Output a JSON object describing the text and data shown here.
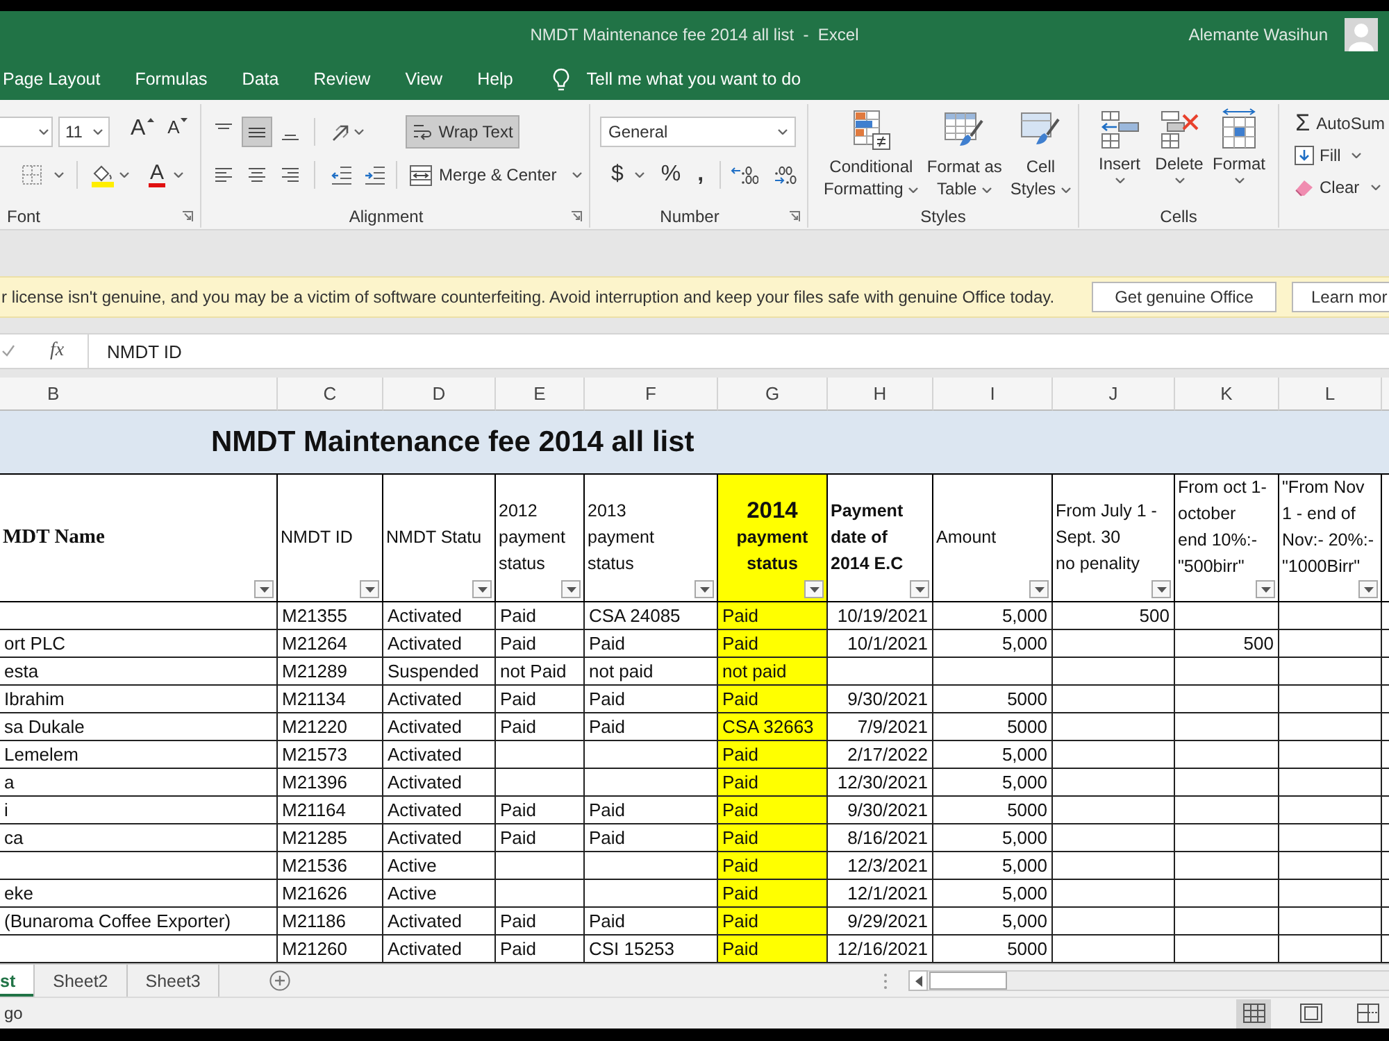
{
  "window": {
    "title": "NMDT Maintenance fee 2014 all list  -  Excel",
    "user": "Alemante Wasihun"
  },
  "ribbon_tabs": [
    "Page Layout",
    "Formulas",
    "Data",
    "Review",
    "View",
    "Help"
  ],
  "tell_me": {
    "placeholder": "Tell me what you want to do"
  },
  "ribbon": {
    "font": {
      "label": "Font",
      "size": "11",
      "grow_glyph": "A",
      "shrink_glyph": "A",
      "color_glyph": "A"
    },
    "alignment": {
      "label": "Alignment",
      "vertical_align": [
        {
          "selected": false
        },
        {
          "selected": true
        },
        {
          "selected": false
        }
      ],
      "wrap_text": {
        "label": "Wrap Text",
        "on": true
      },
      "merge": "Merge & Center"
    },
    "number": {
      "label": "Number",
      "format": "General",
      "currency_glyph": "$",
      "percent_glyph": "%",
      "comma_glyph": ","
    },
    "styles": {
      "label": "Styles",
      "buttons": [
        "Conditional\nFormatting",
        "Format as\nTable",
        "Cell\nStyles"
      ]
    },
    "cells": {
      "label": "Cells",
      "buttons": [
        "Insert",
        "Delete",
        "Format"
      ]
    },
    "editing": {
      "sum_glyph": "Σ",
      "buttons": [
        "AutoSum",
        "Fill",
        "Clear"
      ]
    }
  },
  "notice": {
    "message": "r license isn't genuine, and you may be a victim of software counterfeiting. Avoid interruption and keep your files safe with genuine Office today.",
    "buttons": [
      "Get genuine Office",
      "Learn mor"
    ]
  },
  "formula_bar": {
    "function_glyph": "fx",
    "value": "NMDT ID"
  },
  "sheet": {
    "title": "NMDT Maintenance fee 2014 all list",
    "columns": [
      {
        "letter": "B",
        "header": "MDT Name",
        "bold": true,
        "highlighted": false
      },
      {
        "letter": "C",
        "header": "NMDT ID",
        "bold": false,
        "highlighted": false
      },
      {
        "letter": "D",
        "header": "NMDT Statu",
        "bold": false,
        "highlighted": false
      },
      {
        "letter": "E",
        "header": "2012\npayment\nstatus",
        "bold": false,
        "highlighted": false
      },
      {
        "letter": "F",
        "header": "2013\npayment\nstatus",
        "bold": false,
        "highlighted": false
      },
      {
        "letter": "G",
        "header": "2014\npayment\nstatus",
        "bold": true,
        "highlighted": true
      },
      {
        "letter": "H",
        "header": "Payment\ndate of\n2014 E.C",
        "bold": true,
        "highlighted": false
      },
      {
        "letter": "I",
        "header": "Amount",
        "bold": false,
        "highlighted": false
      },
      {
        "letter": "J",
        "header": "From July 1 -\nSept. 30\nno penality",
        "bold": false,
        "highlighted": false
      },
      {
        "letter": "K",
        "header": "From oct 1-\noctober\nend 10%:-\n\"500birr\"",
        "bold": false,
        "highlighted": false
      },
      {
        "letter": "L",
        "header": "\"From Nov\n1 - end of\nNov:- 20%:-\n\"1000Birr\"",
        "bold": false,
        "highlighted": false
      }
    ],
    "rows": [
      [
        "",
        "M21355",
        "Activated",
        "Paid",
        "CSA 24085",
        "Paid",
        "10/19/2021",
        "5,000",
        "500",
        "",
        ""
      ],
      [
        "ort PLC",
        "M21264",
        "Activated",
        "Paid",
        "Paid",
        "Paid",
        "10/1/2021",
        "5,000",
        "",
        "500",
        ""
      ],
      [
        "esta",
        "M21289",
        "Suspended",
        "not Paid",
        "not paid",
        "not paid",
        "",
        "",
        "",
        "",
        ""
      ],
      [
        "Ibrahim",
        "M21134",
        "Activated",
        "Paid",
        "Paid",
        "Paid",
        "9/30/2021",
        "5000",
        "",
        "",
        ""
      ],
      [
        "sa Dukale",
        "M21220",
        "Activated",
        "Paid",
        "Paid",
        "CSA 32663",
        "7/9/2021",
        "5000",
        "",
        "",
        ""
      ],
      [
        "Lemelem",
        "M21573",
        "Activated",
        "",
        "",
        "Paid",
        "2/17/2022",
        "5,000",
        "",
        "",
        ""
      ],
      [
        "a",
        "M21396",
        "Activated",
        "",
        "",
        "Paid",
        "12/30/2021",
        "5,000",
        "",
        "",
        ""
      ],
      [
        "i",
        "M21164",
        "Activated",
        "Paid",
        "Paid",
        "Paid",
        "9/30/2021",
        "5000",
        "",
        "",
        ""
      ],
      [
        "ca",
        "M21285",
        "Activated",
        "Paid",
        "Paid",
        "Paid",
        "8/16/2021",
        "5,000",
        "",
        "",
        ""
      ],
      [
        "",
        "M21536",
        "Active",
        "",
        "",
        "Paid",
        "12/3/2021",
        "5,000",
        "",
        "",
        ""
      ],
      [
        "eke",
        "M21626",
        "Active",
        "",
        "",
        "Paid",
        "12/1/2021",
        "5,000",
        "",
        "",
        ""
      ],
      [
        "(Bunaroma Coffee Exporter)",
        "M21186",
        "Activated",
        "Paid",
        "Paid",
        "Paid",
        "9/29/2021",
        "5,000",
        "",
        "",
        ""
      ],
      [
        "",
        "M21260",
        "Activated",
        "Paid",
        "CSI 15253",
        "Paid",
        "12/16/2021",
        "5000",
        "",
        "",
        ""
      ]
    ]
  },
  "sheet_tabs": [
    {
      "label": "st",
      "selected": true
    },
    {
      "label": "Sheet2",
      "selected": false
    },
    {
      "label": "Sheet3",
      "selected": false
    }
  ],
  "status_bar": {
    "text": "go",
    "views": [
      {
        "selected": true
      },
      {
        "selected": false
      },
      {
        "selected": false
      }
    ]
  }
}
